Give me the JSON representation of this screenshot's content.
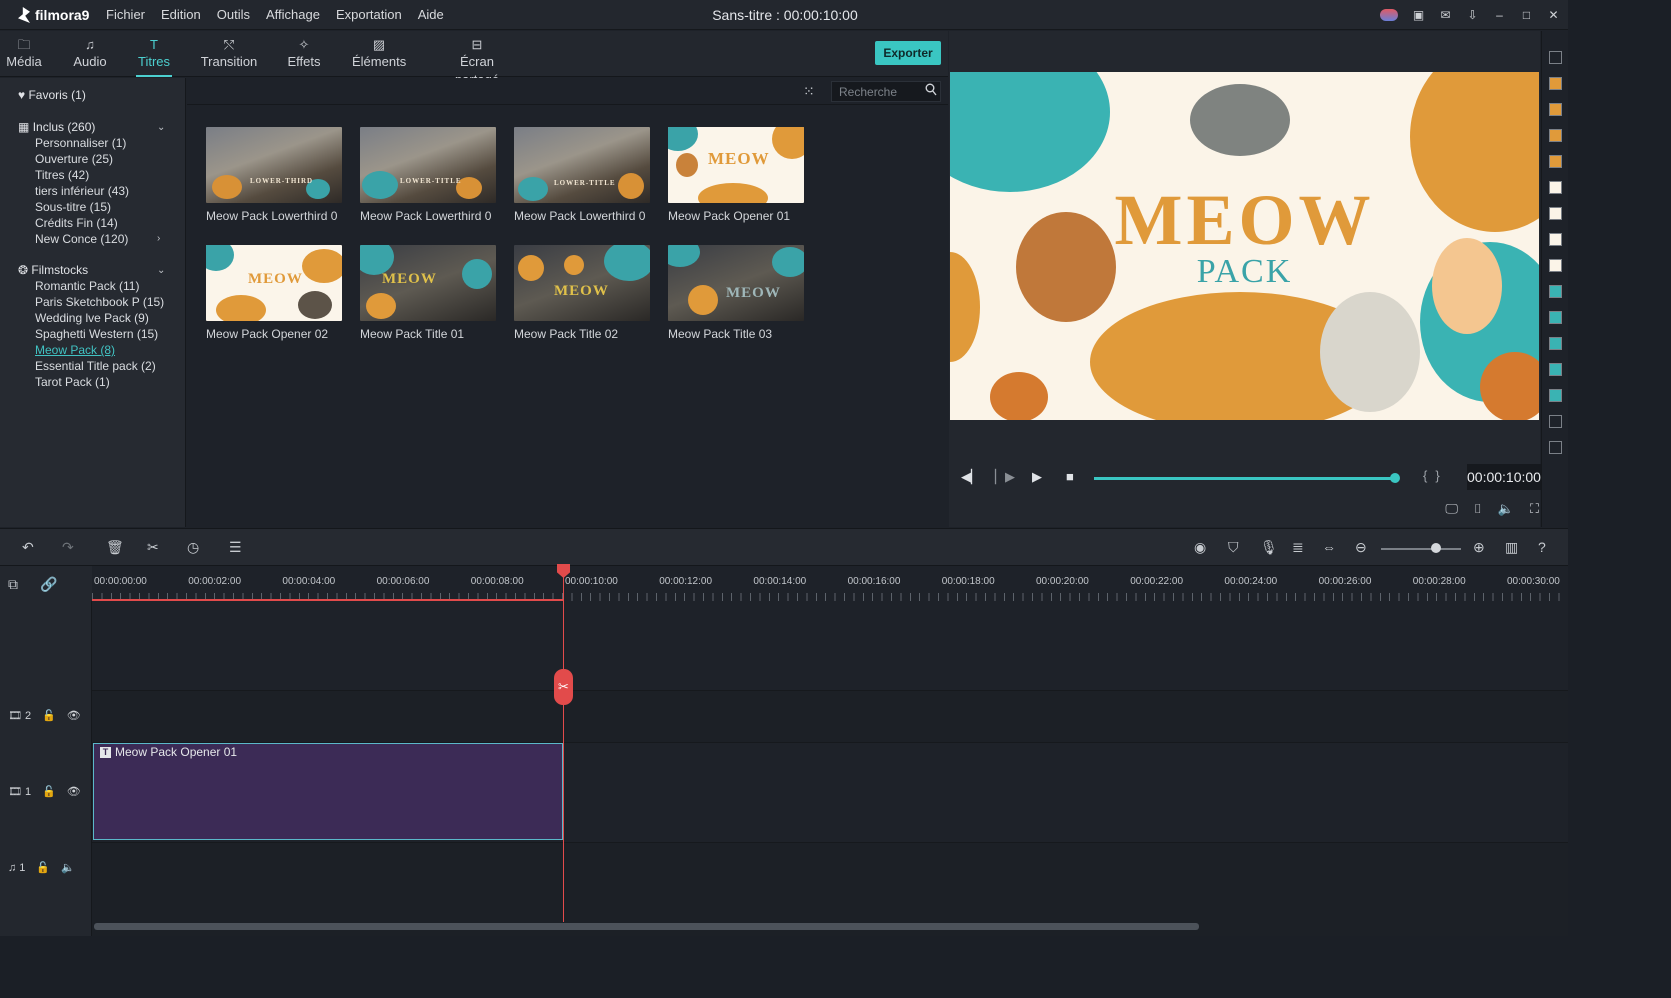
{
  "app": {
    "logo": "filmora9",
    "window_title": "Sans-titre : 00:00:10:00",
    "menu": [
      "Fichier",
      "Edition",
      "Outils",
      "Affichage",
      "Exportation",
      "Aide"
    ]
  },
  "tabs": [
    {
      "label": "Média",
      "icon": "folder-icon"
    },
    {
      "label": "Audio",
      "icon": "music-note-icon"
    },
    {
      "label": "Titres",
      "icon": "title-icon",
      "active": true
    },
    {
      "label": "Transition",
      "icon": "transition-icon"
    },
    {
      "label": "Effets",
      "icon": "effects-icon"
    },
    {
      "label": "Éléments",
      "icon": "image-icon"
    },
    {
      "label": "Écran partagé",
      "icon": "split-screen-icon"
    }
  ],
  "export_label": "Exporter",
  "library": {
    "favoris": "Favoris (1)",
    "inclus": "Inclus (260)",
    "inclus_items": [
      "Personnaliser (1)",
      "Ouverture (25)",
      "Titres (42)",
      "tiers inférieur (43)",
      "Sous-titre (15)",
      "Crédits Fin (14)",
      "New Conce (120)"
    ],
    "filmstocks": "Filmstocks",
    "filmstocks_items": [
      "Romantic Pack (11)",
      "Paris Sketchbook P (15)",
      "Wedding lve Pack (9)",
      "Spaghetti Western  (15)",
      "Meow Pack (8)",
      "Essential Title pack (2)",
      "Tarot Pack (1)"
    ],
    "selected": "Meow Pack (8)"
  },
  "search": {
    "placeholder": "Recherche"
  },
  "grid_items": [
    {
      "caption": "Meow Pack Lowerthird 0",
      "style": "photo",
      "overlay": "LOWER-THIRD"
    },
    {
      "caption": "Meow Pack Lowerthird 0",
      "style": "photo",
      "overlay": "LOWER-TITLE"
    },
    {
      "caption": "Meow Pack Lowerthird 0",
      "style": "photo",
      "overlay": "LOWER-TITLE"
    },
    {
      "caption": "Meow Pack Opener 01",
      "style": "light",
      "overlay": "MEOW"
    },
    {
      "caption": "Meow Pack Opener 02",
      "style": "light",
      "overlay": "MEOW"
    },
    {
      "caption": "Meow Pack Title 01",
      "style": "dark",
      "overlay": "MEOW"
    },
    {
      "caption": "Meow Pack Title 02",
      "style": "dark",
      "overlay": "MEOW"
    },
    {
      "caption": "Meow Pack Title 03",
      "style": "dark",
      "overlay": "MEOW"
    }
  ],
  "preview": {
    "title": "MEOW",
    "subtitle": "PACK",
    "timecode": "00:00:10:00",
    "progress": 1.0
  },
  "colors": {
    "accent": "#3ac6c2",
    "playhead": "#e24b4b",
    "clip": "#3c2b56",
    "meow_orange": "#e09a3a",
    "meow_teal": "#3aa3a8"
  },
  "timeline": {
    "ruler_labels": [
      "00:00:00:00",
      "00:00:02:00",
      "00:00:04:00",
      "00:00:06:00",
      "00:00:08:00",
      "00:00:10:00",
      "00:00:12:00",
      "00:00:14:00",
      "00:00:16:00",
      "00:00:18:00",
      "00:00:20:00",
      "00:00:22:00",
      "00:00:24:00",
      "00:00:26:00",
      "00:00:28:00",
      "00:00:30:00"
    ],
    "tracks": [
      {
        "label": "2",
        "kind": "video"
      },
      {
        "label": "1",
        "kind": "video"
      },
      {
        "label": "1",
        "kind": "audio"
      }
    ],
    "clip": {
      "label": "Meow Pack Opener 01",
      "start": "00:00:00:00",
      "end": "00:00:10:00"
    },
    "playhead": "00:00:10:00"
  }
}
